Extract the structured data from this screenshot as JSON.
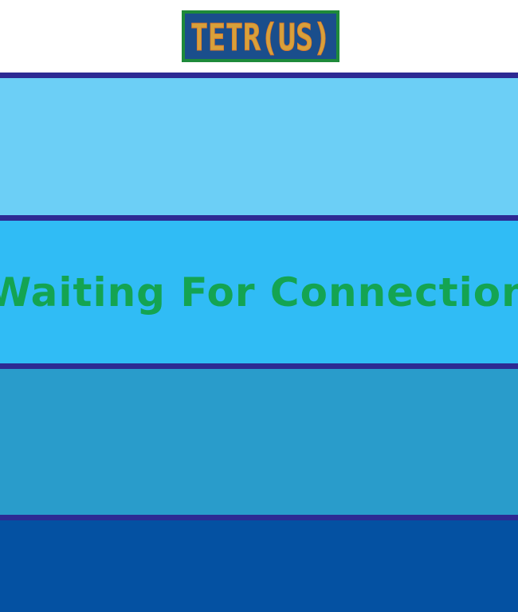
{
  "logo": {
    "text": "TETR(US)",
    "background_color": "#1a4e8c",
    "border_color": "#1e8a3a",
    "text_color": "#d7a13a"
  },
  "status": {
    "message": "Waiting For Connection",
    "color": "#14a452"
  },
  "colors": {
    "divider": "#2d2a93",
    "band_1": "#6ccff6",
    "band_2": "#30bcf5",
    "band_3": "#299ccb",
    "band_4": "#0451a2"
  }
}
